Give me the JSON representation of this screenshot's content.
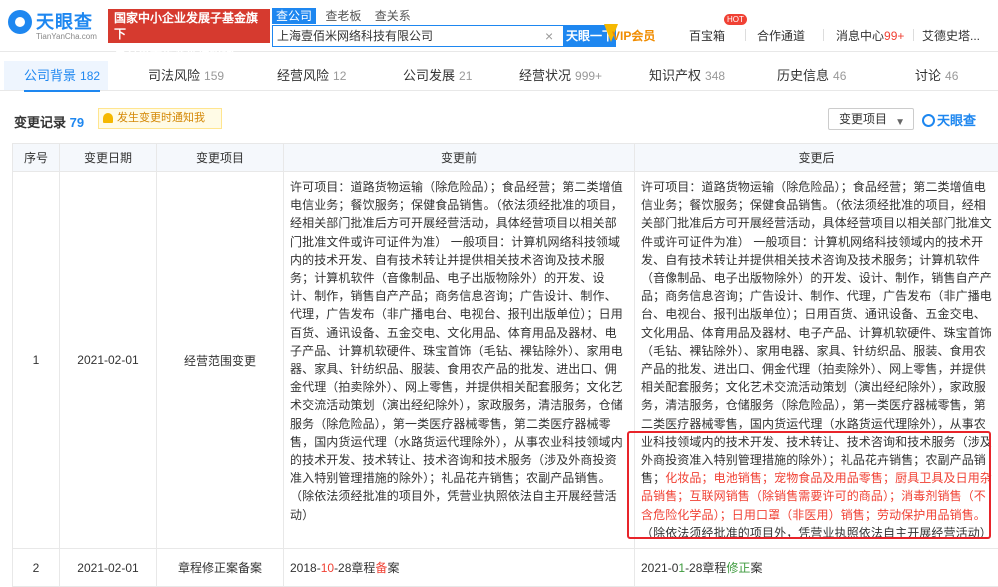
{
  "header": {
    "logo_name": "天眼查",
    "logo_domain": "TianYanCha.com",
    "banner_line1": "国家中小企业发展子基金旗下",
    "banner_line2": "官方备案企业征信机构",
    "search_tabs": [
      "查公司",
      "查老板",
      "查关系"
    ],
    "search_value": "上海壹佰米网络科技有限公司",
    "search_button": "天眼一下",
    "vip_label": "VIP会员",
    "nav": {
      "baibao": "百宝箱",
      "hot_badge": "HOT",
      "cooperation": "合作通道",
      "messages": "消息中心",
      "messages_count": "99+",
      "user": "艾德史塔..."
    }
  },
  "tabs": [
    {
      "label": "公司背景",
      "count": "182"
    },
    {
      "label": "司法风险",
      "count": "159"
    },
    {
      "label": "经营风险",
      "count": "12"
    },
    {
      "label": "公司发展",
      "count": "21"
    },
    {
      "label": "经营状况",
      "count": "999+"
    },
    {
      "label": "知识产权",
      "count": "348"
    },
    {
      "label": "历史信息",
      "count": "46"
    },
    {
      "label": "讨论",
      "count": "46"
    }
  ],
  "section": {
    "title": "变更记录",
    "count": "79",
    "notify": "发生变更时通知我",
    "filter": "变更项目",
    "watermark": "天眼查"
  },
  "table": {
    "headers": [
      "序号",
      "变更日期",
      "变更项目",
      "变更前",
      "变更后"
    ],
    "rows": [
      {
        "no": "1",
        "date": "2021-02-01",
        "item": "经营范围变更",
        "before": "许可项目：道路货物运输（除危险品）；食品经营；第二类增值电信业务；餐饮服务；保健食品销售。（依法须经批准的项目，经相关部门批准后方可开展经营活动，具体经营项目以相关部门批准文件或许可证件为准） 一般项目：计算机网络科技领域内的技术开发、自有技术转让并提供相关技术咨询及技术服务；计算机软件（音像制品、电子出版物除外）的开发、设计、制作，销售自产产品；商务信息咨询；广告设计、制作、代理，广告发布（非广播电台、电视台、报刊出版单位）；日用百货、通讯设备、五金交电、文化用品、体育用品及器材、电子产品、计算机软硬件、珠宝首饰（毛钻、裸钻除外）、家用电器、家具、针纺织品、服装、食用农产品的批发、进出口、佣金代理（拍卖除外）、网上零售，并提供相关配套服务；文化艺术交流活动策划（演出经纪除外），家政服务，清洁服务，仓储服务（除危险品），第一类医疗器械零售，第二类医疗器械零售，国内货运代理（水路货运代理除外），从事农业科技领域内的技术开发、技术转让、技术咨询和技术服务（涉及外商投资准入特别管理措施的除外）；礼品花卉销售；农副产品销售。（除依法须经批准的项目外，凭营业执照依法自主开展经营活动）",
        "after_plain": "许可项目：道路货物运输（除危险品）；食品经营；第二类增值电信业务；餐饮服务；保健食品销售。（依法须经批准的项目，经相关部门批准后方可开展经营活动，具体经营项目以相关部门批准文件或许可证件为准） 一般项目：计算机网络科技领域内的技术开发、自有技术转让并提供相关技术咨询及技术服务；计算机软件（音像制品、电子出版物除外）的开发、设计、制作，销售自产产品；商务信息咨询；广告设计、制作、代理，广告发布（非广播电台、电视台、报刊出版单位）；日用百货、通讯设备、五金交电、文化用品、体育用品及器材、电子产品、计算机软硬件、珠宝首饰（毛钻、裸钻除外）、家用电器、家具、针纺织品、服装、食用农产品的批发、进出口、佣金代理（拍卖除外）、网上零售，并提供相关配套服务；文化艺术交流活动策划（演出经纪除外），家政服务，清洁服务，仓储服务（除危险品），第一类医疗器械零售，第二类医疗器械零售，国内货运代理（水路货运代理除外），从事农业科技领域内的技术开发、技术转让、技术咨询和技术服务（涉及外商投资准入特别管理措施的除外）；礼品花卉销售；农副产品销售；",
        "after_highlight": "化妆品；电池销售；宠物食品及用品零售；厨具卫具及日用杂品销售；互联网销售（除销售需要许可的商品）；消毒剂销售（不含危险化学品）；日用口罩（非医用）销售；劳动保护用品销售。",
        "after_tail": "（除依法须经批准的项目外，凭营业执照依法自主开展经营活动）"
      },
      {
        "no": "2",
        "date": "2021-02-01",
        "item": "章程修正案备案",
        "before_a": "2018-",
        "before_b": "10",
        "before_c": "-28章程",
        "before_d": "备",
        "before_e": "案",
        "after_a": "2021-0",
        "after_b": "1",
        "after_c": "-28章程",
        "after_d": "修正",
        "after_e": "案"
      }
    ]
  }
}
